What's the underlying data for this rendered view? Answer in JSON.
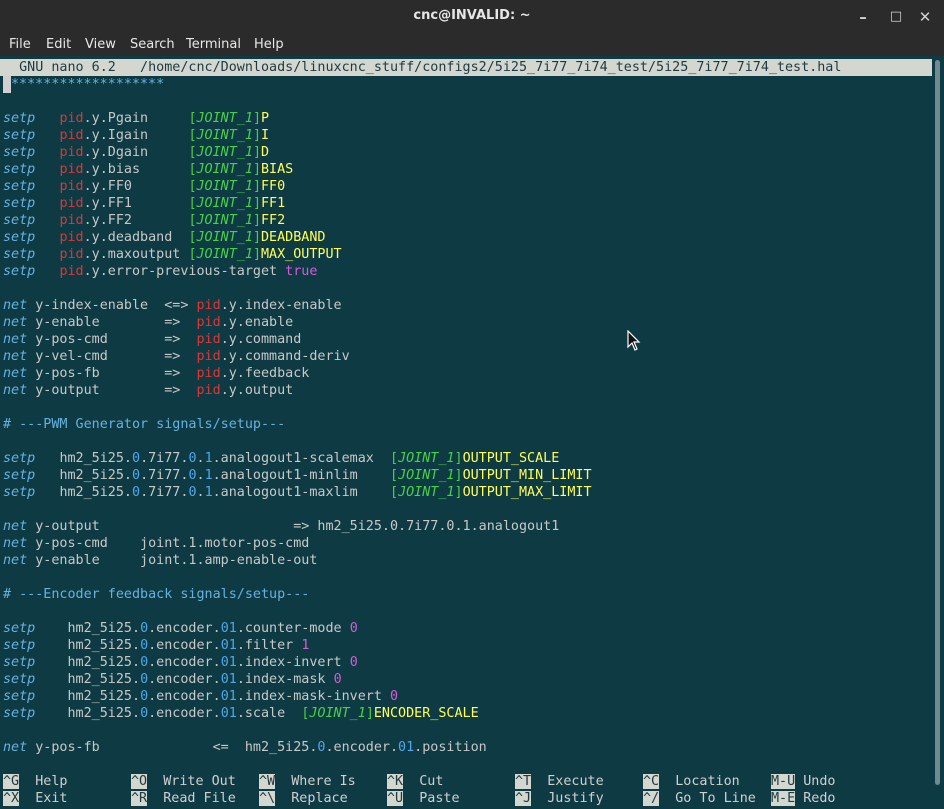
{
  "window": {
    "title": "cnc@INVALID: ~",
    "min_icon": "minimize-icon",
    "max_icon": "maximize-icon",
    "close_icon": "close-icon"
  },
  "menubar": {
    "items": [
      "File",
      "Edit",
      "View",
      "Search",
      "Terminal",
      "Help"
    ]
  },
  "nano": {
    "header": "  GNU nano 6.2   /home/cnc/Downloads/linuxcnc_stuff/configs2/5i25_7i77_7i74_test/5i25_7i77_7i74_test.hal",
    "partial_line": "*******************",
    "lines": [
      {
        "t": "setp",
        "c": "pid",
        "s": "y.Pgain     ",
        "v": "P"
      },
      {
        "t": "setp",
        "c": "pid",
        "s": "y.Igain     ",
        "v": "I"
      },
      {
        "t": "setp",
        "c": "pid",
        "s": "y.Dgain     ",
        "v": "D"
      },
      {
        "t": "setp",
        "c": "pid",
        "s": "y.bias      ",
        "v": "BIAS"
      },
      {
        "t": "setp",
        "c": "pid",
        "s": "y.FF0       ",
        "v": "FF0"
      },
      {
        "t": "setp",
        "c": "pid",
        "s": "y.FF1       ",
        "v": "FF1"
      },
      {
        "t": "setp",
        "c": "pid",
        "s": "y.FF2       ",
        "v": "FF2"
      },
      {
        "t": "setp",
        "c": "pid",
        "s": "y.deadband  ",
        "v": "DEADBAND"
      },
      {
        "t": "setp",
        "c": "pid",
        "s": "y.maxoutput ",
        "v": "MAX_OUTPUT"
      }
    ],
    "joint_token": "JOINT_1",
    "error_prev": {
      "name": "y.error-previous-target ",
      "value": "true"
    },
    "nets1": [
      {
        "sig": "y-index-enable  <=> ",
        "pin": "y.index-enable"
      },
      {
        "sig": "y-enable        =>  ",
        "pin": "y.enable"
      },
      {
        "sig": "y-pos-cmd       =>  ",
        "pin": "y.command"
      },
      {
        "sig": "y-vel-cmd       =>  ",
        "pin": "y.command-deriv"
      },
      {
        "sig": "y-pos-fb        =>  ",
        "pin": "y.feedback"
      },
      {
        "sig": "y-output        =>  ",
        "pin": "y.output"
      }
    ],
    "comment_pwm": "# ---PWM Generator signals/setup---",
    "pwm": [
      {
        "a": "hm2_5i25",
        "b": "0",
        "c": "7i77",
        "d": "0",
        "e": "1",
        "f": "analogout1-scalemax  ",
        "v": "OUTPUT_SCALE"
      },
      {
        "a": "hm2_5i25",
        "b": "0",
        "c": "7i77",
        "d": "0",
        "e": "1",
        "f": "analogout1-minlim    ",
        "v": "OUTPUT_MIN_LIMIT"
      },
      {
        "a": "hm2_5i25",
        "b": "0",
        "c": "7i77",
        "d": "0",
        "e": "1",
        "f": "analogout1-maxlim    ",
        "v": "OUTPUT_MAX_LIMIT"
      }
    ],
    "nets2": [
      "y-output                        => hm2_5i25.0.7i77.0.1.analogout1",
      "y-pos-cmd    joint.1.motor-pos-cmd",
      "y-enable     joint.1.amp-enable-out"
    ],
    "comment_enc": "# ---Encoder feedback signals/setup---",
    "enc": [
      {
        "f": "counter-mode ",
        "v": "0"
      },
      {
        "f": "filter ",
        "v": "1"
      },
      {
        "f": "index-invert ",
        "v": "0"
      },
      {
        "f": "index-mask ",
        "v": "0"
      },
      {
        "f": "index-mask-invert ",
        "v": "0"
      }
    ],
    "enc_scale": {
      "f": "scale  ",
      "v": "ENCODER_SCALE"
    },
    "net_fb": {
      "sig": "y-pos-fb              <=  ",
      "pin": "hm2_5i25.0.encoder.01.position"
    },
    "shortcuts": [
      [
        {
          "k": "^G",
          "l": "Help"
        },
        {
          "k": "^O",
          "l": "Write Out"
        },
        {
          "k": "^W",
          "l": "Where Is"
        },
        {
          "k": "^K",
          "l": "Cut"
        },
        {
          "k": "^T",
          "l": "Execute"
        },
        {
          "k": "^C",
          "l": "Location"
        },
        {
          "k": "M-U",
          "l": "Undo"
        }
      ],
      [
        {
          "k": "^X",
          "l": "Exit"
        },
        {
          "k": "^R",
          "l": "Read File"
        },
        {
          "k": "^\\",
          "l": "Replace"
        },
        {
          "k": "^U",
          "l": "Paste"
        },
        {
          "k": "^J",
          "l": "Justify"
        },
        {
          "k": "^/",
          "l": "Go To Line"
        },
        {
          "k": "M-E",
          "l": "Redo"
        }
      ]
    ]
  }
}
